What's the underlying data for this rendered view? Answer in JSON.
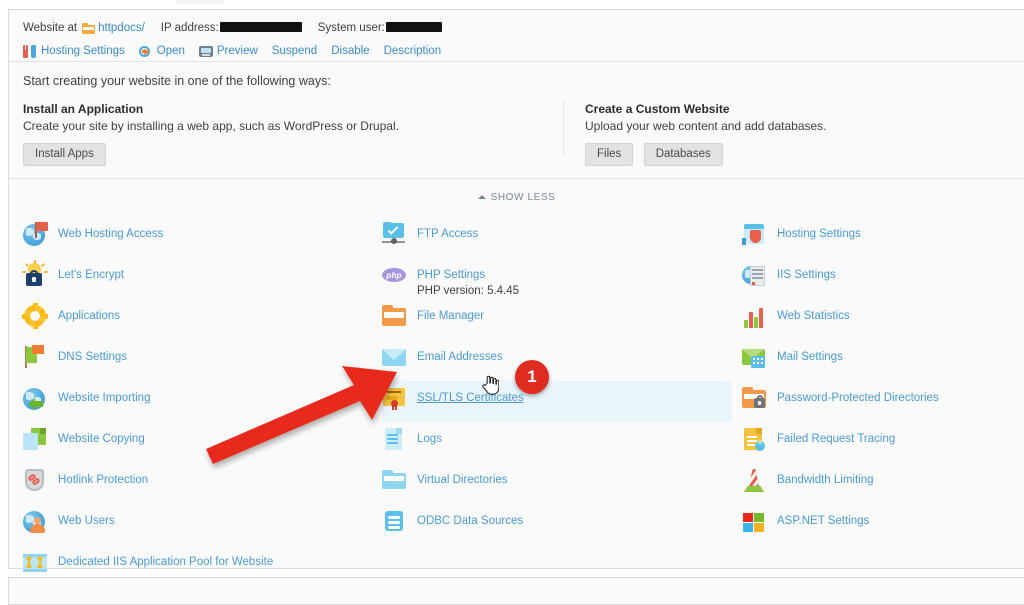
{
  "header": {
    "website_at_label": "Website at",
    "folder_name": "httpdocs/",
    "ip_label": "IP address:",
    "ip_value_redacted": true,
    "system_user_label": "System user:",
    "system_user_redacted": true,
    "actions": [
      {
        "label": "Hosting Settings",
        "icon": "tools-icon"
      },
      {
        "label": "Open",
        "icon": "open-external-icon"
      },
      {
        "label": "Preview",
        "icon": "preview-monitor-icon"
      },
      {
        "label": "Suspend",
        "icon": null
      },
      {
        "label": "Disable",
        "icon": null
      },
      {
        "label": "Description",
        "icon": null
      }
    ]
  },
  "create": {
    "intro": "Start creating your website in one of the following ways:",
    "left": {
      "title": "Install an Application",
      "desc": "Create your site by installing a web app, such as WordPress or Drupal.",
      "buttons": [
        "Install Apps"
      ]
    },
    "right": {
      "title": "Create a Custom Website",
      "desc": "Upload your web content and add databases.",
      "buttons": [
        "Files",
        "Databases"
      ]
    },
    "show_less": "SHOW LESS"
  },
  "tools": {
    "column1": [
      {
        "label": "Web Hosting Access",
        "icon": "globe-flag-icon"
      },
      {
        "label": "Let's Encrypt",
        "icon": "sun-lock-icon"
      },
      {
        "label": "Applications",
        "icon": "gear-icon"
      },
      {
        "label": "DNS Settings",
        "icon": "flags-icon"
      },
      {
        "label": "Website Importing",
        "icon": "globe-import-arrow-icon"
      },
      {
        "label": "Website Copying",
        "icon": "copy-documents-icon"
      },
      {
        "label": "Hotlink Protection",
        "icon": "shield-chain-icon"
      },
      {
        "label": "Web Users",
        "icon": "globe-user-icon"
      },
      {
        "label": "Dedicated IIS Application Pool for Website",
        "icon": "app-pool-icon"
      }
    ],
    "column2": [
      {
        "label": "FTP Access",
        "icon": "ftp-folder-check-icon"
      },
      {
        "label": "PHP Settings",
        "icon": "php-icon",
        "sublabel": "PHP version: 5.4.45"
      },
      {
        "label": "File Manager",
        "icon": "orange-folder-icon"
      },
      {
        "label": "Email Addresses",
        "icon": "envelope-icon"
      },
      {
        "label": "SSL/TLS Certificates",
        "icon": "certificate-icon",
        "highlighted": true
      },
      {
        "label": "Logs",
        "icon": "document-lines-icon"
      },
      {
        "label": "Virtual Directories",
        "icon": "blue-folder-icon"
      },
      {
        "label": "ODBC Data Sources",
        "icon": "database-icon"
      }
    ],
    "column3": [
      {
        "label": "Hosting Settings",
        "icon": "hosting-shield-icon"
      },
      {
        "label": "IIS Settings",
        "icon": "globe-server-icon"
      },
      {
        "label": "Web Statistics",
        "icon": "bar-chart-icon"
      },
      {
        "label": "Mail Settings",
        "icon": "green-envelope-icon"
      },
      {
        "label": "Password-Protected Directories",
        "icon": "folder-lock-icon"
      },
      {
        "label": "Failed Request Tracing",
        "icon": "document-error-icon"
      },
      {
        "label": "Bandwidth Limiting",
        "icon": "traffic-cone-icon"
      },
      {
        "label": "ASP.NET Settings",
        "icon": "windows-squares-icon"
      }
    ]
  },
  "annotation": {
    "badge_number": "1",
    "arrow_color": "#e8291c",
    "target": "SSL/TLS Certificates",
    "cursor": "pointing-hand-cursor"
  },
  "colors": {
    "link": "#4a9ad4",
    "highlight_row": "#eaf4fb",
    "page_bg": "#fafafa",
    "annotation_red": "#e02b21"
  }
}
